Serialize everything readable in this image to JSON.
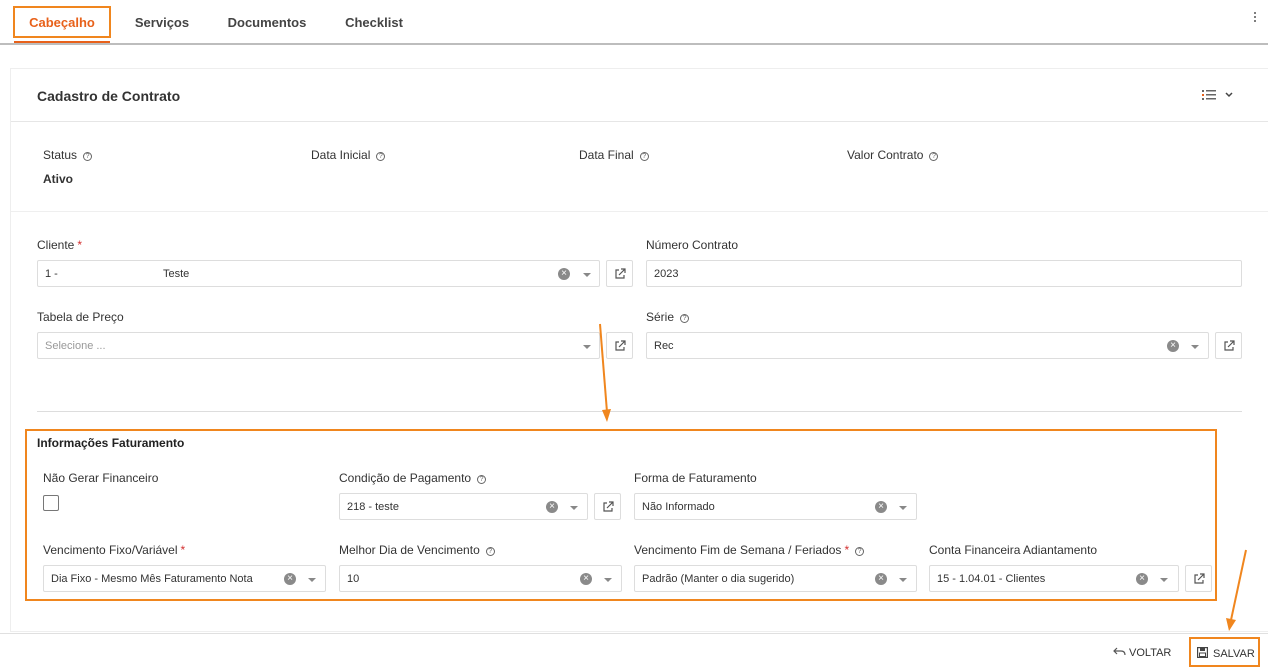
{
  "tabs": [
    {
      "label": "Cabeçalho",
      "active": true
    },
    {
      "label": "Serviços"
    },
    {
      "label": "Documentos"
    },
    {
      "label": "Checklist"
    }
  ],
  "card": {
    "title": "Cadastro de Contrato"
  },
  "summary": {
    "status_label": "Status",
    "status_value": "Ativo",
    "data_inicial_label": "Data Inicial",
    "data_final_label": "Data Final",
    "valor_contrato_label": "Valor Contrato"
  },
  "form": {
    "cliente_label": "Cliente",
    "cliente_code": "1 -",
    "cliente_name": "Teste",
    "numero_contrato_label": "Número Contrato",
    "numero_contrato_value": "2023",
    "tabela_preco_label": "Tabela de Preço",
    "tabela_preco_placeholder": "Selecione ...",
    "serie_label": "Série",
    "serie_value": "Rec"
  },
  "faturamento": {
    "title": "Informações Faturamento",
    "nao_gerar_label": "Não Gerar Financeiro",
    "condicao_label": "Condição de Pagamento",
    "condicao_value": "218 - teste",
    "forma_label": "Forma de Faturamento",
    "forma_value": "Não Informado",
    "vencimento_label": "Vencimento Fixo/Variável",
    "vencimento_value": "Dia Fixo - Mesmo Mês Faturamento Nota",
    "melhor_dia_label": "Melhor Dia de Vencimento",
    "melhor_dia_value": "10",
    "fim_semana_label": "Vencimento Fim de Semana / Feriados",
    "fim_semana_value": "Padrão (Manter o dia sugerido)",
    "conta_label": "Conta Financeira Adiantamento",
    "conta_value": "15 - 1.04.01 - Clientes"
  },
  "footer": {
    "voltar_label": "VOLTAR",
    "salvar_label": "SALVAR"
  },
  "colors": {
    "accent": "#e8611a",
    "highlight": "#f0861e"
  }
}
